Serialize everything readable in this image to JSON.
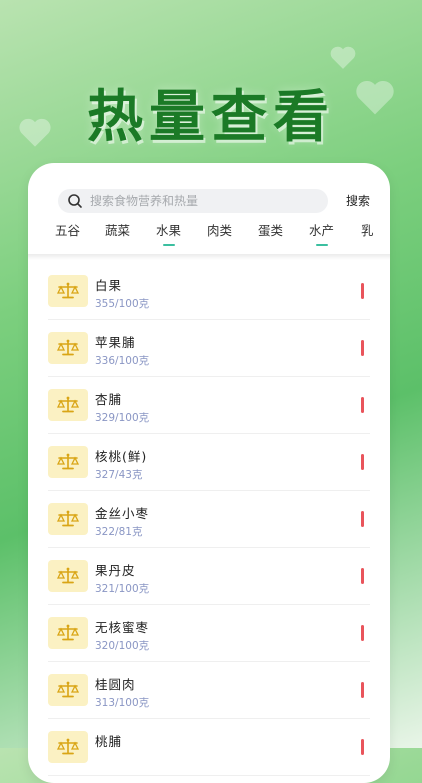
{
  "header": {
    "title": "热量查看"
  },
  "search": {
    "placeholder": "搜索食物营养和热量",
    "button_label": "搜索"
  },
  "tabs": [
    {
      "label": "五谷",
      "active": false
    },
    {
      "label": "蔬菜",
      "active": false
    },
    {
      "label": "水果",
      "active": true
    },
    {
      "label": "肉类",
      "active": false
    },
    {
      "label": "蛋类",
      "active": false
    },
    {
      "label": "水产",
      "active": false
    },
    {
      "label": "乳",
      "active": false
    }
  ],
  "foods": [
    {
      "name": "白果",
      "calories": "355/100克"
    },
    {
      "name": "苹果脯",
      "calories": "336/100克"
    },
    {
      "name": "杏脯",
      "calories": "329/100克"
    },
    {
      "name": "核桃(鲜)",
      "calories": "327/43克"
    },
    {
      "name": "金丝小枣",
      "calories": "322/81克"
    },
    {
      "name": "果丹皮",
      "calories": "321/100克"
    },
    {
      "name": "无核蜜枣",
      "calories": "320/100克"
    },
    {
      "name": "桂圆肉",
      "calories": "313/100克"
    },
    {
      "name": "桃脯",
      "calories": ""
    }
  ],
  "colors": {
    "accent": "#3bbfa0",
    "title": "#1b7a26",
    "calorie_text": "#8a96c4",
    "level_bar": "#e9545b",
    "icon_bg": "#fbf1c3"
  },
  "icons": {
    "food_item": "scale-icon",
    "search": "search-icon"
  }
}
